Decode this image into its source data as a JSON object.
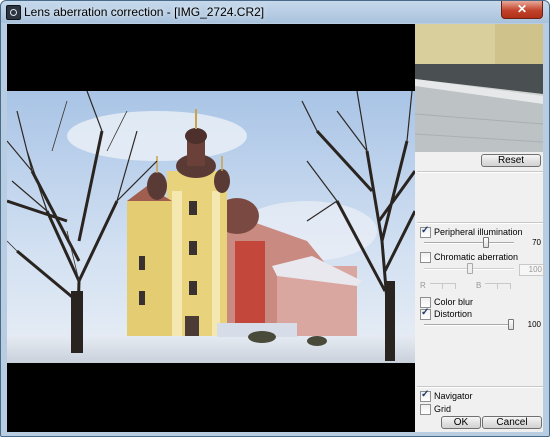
{
  "window": {
    "title": "Lens aberration correction - [IMG_2724.CR2]",
    "close_glyph": "✕",
    "accent": "#c2432b"
  },
  "sidebar": {
    "reset_label": "Reset",
    "peripheral": {
      "label": "Peripheral illumination",
      "checked": true,
      "value": "70",
      "level_percent": 70
    },
    "chromatic": {
      "label": "Chromatic aberration",
      "checked": false,
      "value": "100",
      "r_label": "R",
      "b_label": "B"
    },
    "color_blur": {
      "label": "Color blur",
      "checked": false
    },
    "distortion": {
      "label": "Distortion",
      "checked": true,
      "value": "100",
      "level_percent": 100
    },
    "navigator": {
      "label": "Navigator",
      "checked": true
    },
    "grid": {
      "label": "Grid",
      "checked": false
    }
  },
  "footer": {
    "ok_label": "OK",
    "cancel_label": "Cancel"
  }
}
